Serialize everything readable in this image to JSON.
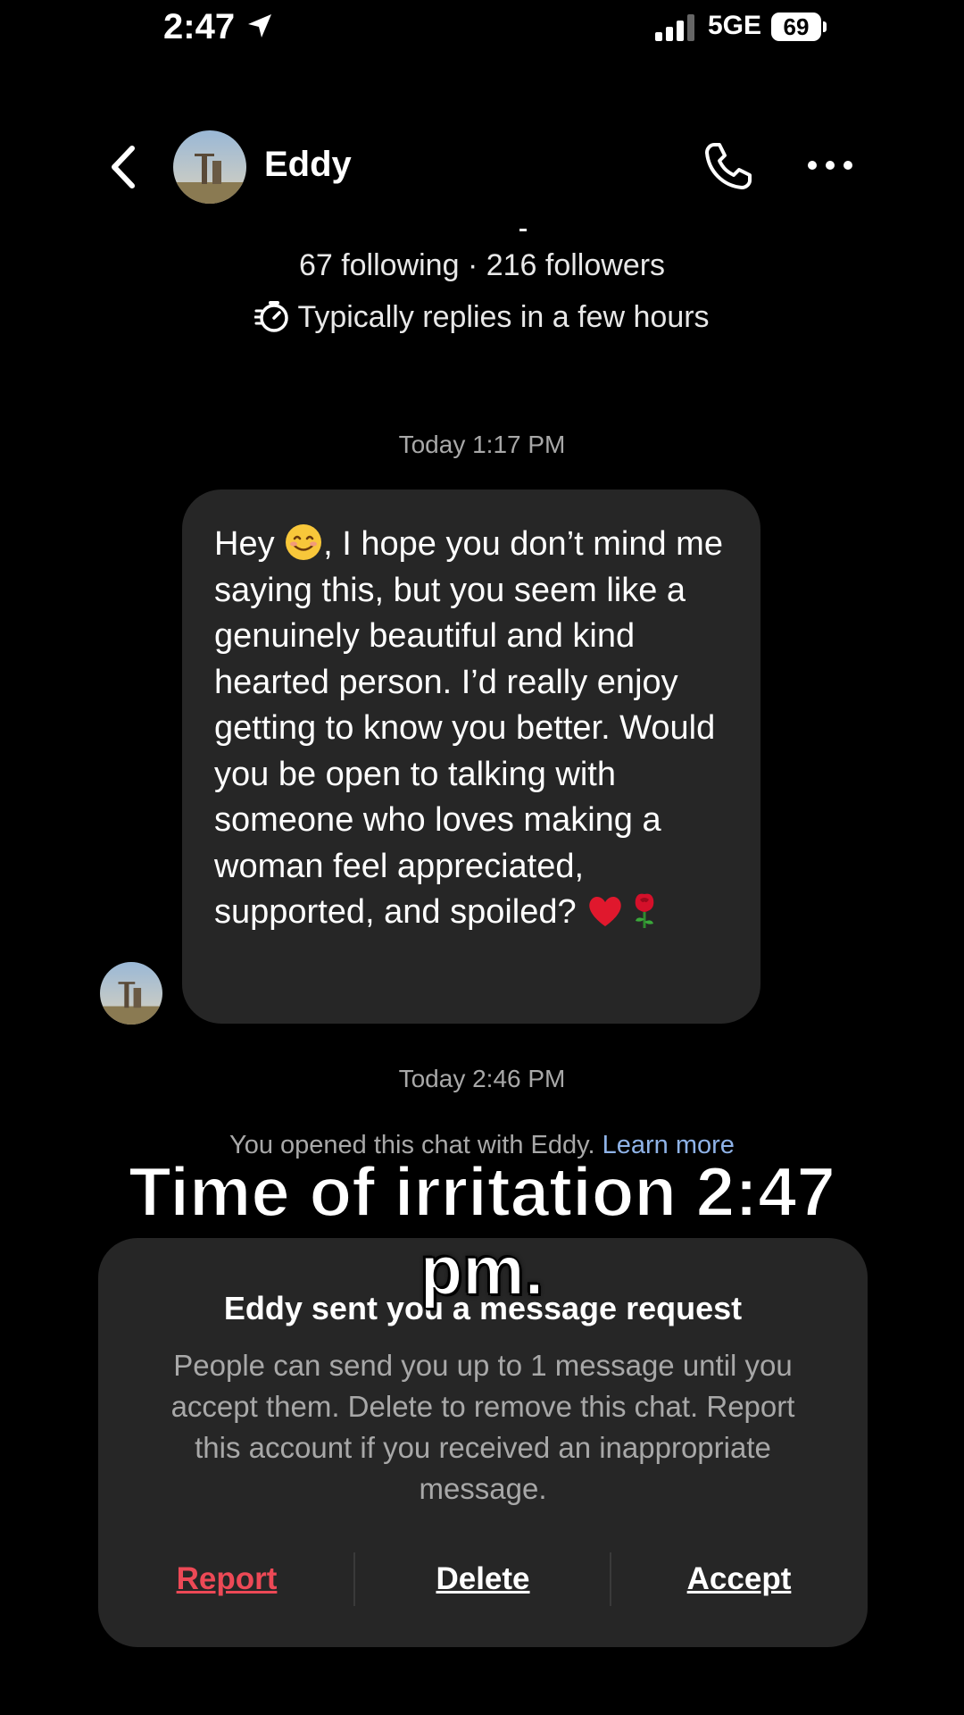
{
  "status_bar": {
    "time": "2:47",
    "network": "5GE",
    "battery": "69"
  },
  "header": {
    "contact_name": "Eddy"
  },
  "profile": {
    "stats": "67 following · 216 followers",
    "reply_time": "Typically replies in a few hours"
  },
  "messages": {
    "timestamp_1": "Today 1:17 PM",
    "msg_hey": "Hey",
    "msg_body_1": ", I hope you don’t mind me saying this, but you seem like a genuinely beautiful and kind hearted person. I’d really enjoy getting to know you better. Would you be open to talking with someone who loves making a woman feel appreciated, supported, and spoiled?",
    "timestamp_2": "Today 2:46 PM",
    "opened_note": "You opened this chat with Eddy.",
    "learn_more": "Learn more"
  },
  "request_card": {
    "title": "Eddy sent you a message request",
    "body": "People can send you up to 1 message until you accept them. Delete to remove this chat. Report this account if you received an inappropriate message.",
    "report_label": "Report",
    "delete_label": "Delete",
    "accept_label": "Accept"
  },
  "overlay_caption": "Time of irritation 2:47 pm.",
  "colors": {
    "background": "#000000",
    "bubble": "#262626",
    "muted_text": "#a8a8a8",
    "link": "#8fb3e8",
    "report": "#ed4956"
  }
}
